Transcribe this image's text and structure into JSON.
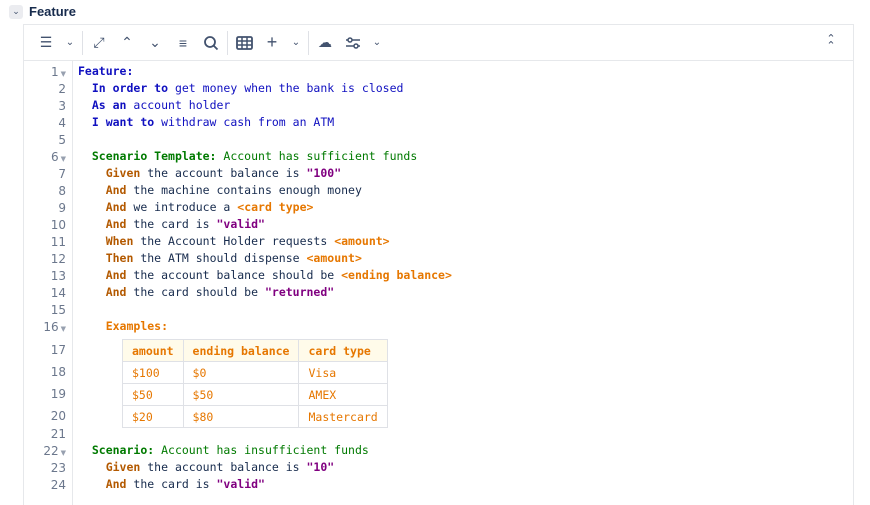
{
  "section": {
    "title": "Feature"
  },
  "toolbar": [
    "list-icon",
    "chevron-down-icon",
    "expand-icon",
    "collapse-up-icon",
    "collapse-down-icon",
    "align-icon",
    "search-icon",
    "table-icon",
    "plus-icon",
    "chevron-down-icon",
    "cloud-download-icon",
    "settings-sliders-icon",
    "chevron-down-icon",
    "double-chevron-up-icon"
  ],
  "lines": [
    {
      "n": "1",
      "fold": true,
      "tokens": [
        {
          "t": "Feature:",
          "c": "kw"
        }
      ]
    },
    {
      "n": "2",
      "tokens": [
        {
          "t": "  "
        },
        {
          "t": "In order to",
          "c": "kw"
        },
        {
          "t": " get money when the bank is closed",
          "c": "bl"
        }
      ]
    },
    {
      "n": "3",
      "tokens": [
        {
          "t": "  "
        },
        {
          "t": "As an",
          "c": "kw"
        },
        {
          "t": " account holder",
          "c": "bl"
        }
      ]
    },
    {
      "n": "4",
      "tokens": [
        {
          "t": "  "
        },
        {
          "t": "I want to",
          "c": "kw"
        },
        {
          "t": " withdraw cash from an ATM",
          "c": "bl"
        }
      ]
    },
    {
      "n": "5",
      "tokens": []
    },
    {
      "n": "6",
      "fold": true,
      "tokens": [
        {
          "t": "  "
        },
        {
          "t": "Scenario Template:",
          "c": "sc"
        },
        {
          "t": " Account has sufficient funds",
          "c": "gr"
        }
      ]
    },
    {
      "n": "7",
      "tokens": [
        {
          "t": "    "
        },
        {
          "t": "Given",
          "c": "st"
        },
        {
          "t": " the account balance is ",
          "c": "tx"
        },
        {
          "t": "\"100\"",
          "c": "str"
        }
      ]
    },
    {
      "n": "8",
      "tokens": [
        {
          "t": "    "
        },
        {
          "t": "And",
          "c": "st"
        },
        {
          "t": " the machine contains enough money",
          "c": "tx"
        }
      ]
    },
    {
      "n": "9",
      "tokens": [
        {
          "t": "    "
        },
        {
          "t": "And",
          "c": "st"
        },
        {
          "t": " we introduce a ",
          "c": "tx"
        },
        {
          "t": "<card type>",
          "c": "ph"
        }
      ]
    },
    {
      "n": "10",
      "tokens": [
        {
          "t": "    "
        },
        {
          "t": "And",
          "c": "st"
        },
        {
          "t": " the card is ",
          "c": "tx"
        },
        {
          "t": "\"valid\"",
          "c": "str"
        }
      ]
    },
    {
      "n": "11",
      "tokens": [
        {
          "t": "    "
        },
        {
          "t": "When",
          "c": "st"
        },
        {
          "t": " the Account Holder requests ",
          "c": "tx"
        },
        {
          "t": "<amount>",
          "c": "ph"
        }
      ]
    },
    {
      "n": "12",
      "tokens": [
        {
          "t": "    "
        },
        {
          "t": "Then",
          "c": "st"
        },
        {
          "t": " the ATM should dispense ",
          "c": "tx"
        },
        {
          "t": "<amount>",
          "c": "ph"
        }
      ]
    },
    {
      "n": "13",
      "tokens": [
        {
          "t": "    "
        },
        {
          "t": "And",
          "c": "st"
        },
        {
          "t": " the account balance should be ",
          "c": "tx"
        },
        {
          "t": "<ending balance>",
          "c": "ph"
        }
      ]
    },
    {
      "n": "14",
      "tokens": [
        {
          "t": "    "
        },
        {
          "t": "And",
          "c": "st"
        },
        {
          "t": " the card should be ",
          "c": "tx"
        },
        {
          "t": "\"returned\"",
          "c": "str"
        }
      ]
    },
    {
      "n": "15",
      "tokens": []
    },
    {
      "n": "16",
      "fold": true,
      "tokens": [
        {
          "t": "    "
        },
        {
          "t": "Examples:",
          "c": "ex"
        }
      ]
    },
    {
      "n": "17",
      "tokens": []
    },
    {
      "n": "18",
      "tokens": []
    },
    {
      "n": "19",
      "tokens": []
    },
    {
      "n": "20",
      "tokens": []
    },
    {
      "n": "21",
      "tokens": []
    },
    {
      "n": "22",
      "fold": true,
      "tokens": [
        {
          "t": "  "
        },
        {
          "t": "Scenario:",
          "c": "sc"
        },
        {
          "t": " Account has insufficient funds",
          "c": "gr"
        }
      ]
    },
    {
      "n": "23",
      "tokens": [
        {
          "t": "    "
        },
        {
          "t": "Given",
          "c": "st"
        },
        {
          "t": " the account balance is ",
          "c": "tx"
        },
        {
          "t": "\"10\"",
          "c": "str"
        }
      ]
    },
    {
      "n": "24",
      "tokens": [
        {
          "t": "    "
        },
        {
          "t": "And",
          "c": "st"
        },
        {
          "t": " the card is ",
          "c": "tx"
        },
        {
          "t": "\"valid\"",
          "c": "str"
        }
      ]
    }
  ],
  "examples": {
    "header": [
      "amount",
      "ending balance",
      "card type"
    ],
    "rows": [
      [
        "$100",
        "$0",
        "Visa"
      ],
      [
        "$50",
        "$50",
        "AMEX"
      ],
      [
        "$20",
        "$80",
        "Mastercard"
      ]
    ]
  }
}
